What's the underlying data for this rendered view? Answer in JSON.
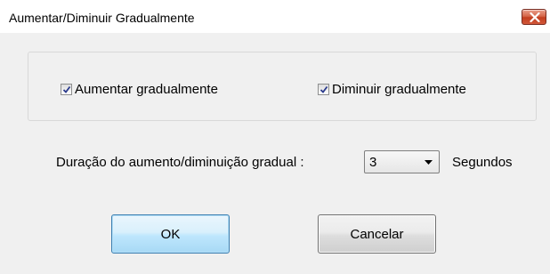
{
  "window": {
    "title": "Aumentar/Diminuir Gradualmente"
  },
  "options": {
    "fade_in": {
      "label": "Aumentar gradualmente",
      "checked": true
    },
    "fade_out": {
      "label": "Diminuir gradualmente",
      "checked": true
    }
  },
  "duration": {
    "label": "Duração do aumento/diminuição gradual :",
    "value": "3",
    "unit": "Segundos"
  },
  "buttons": {
    "ok": "OK",
    "cancel": "Cancelar"
  },
  "icons": {
    "close": "close-icon",
    "checkmark": "checkmark-icon",
    "dropdown": "chevron-down-icon"
  },
  "colors": {
    "close_button": "#c23e1f",
    "ok_button_border": "#3c7fb1",
    "dialog_background": "#f0f0f0"
  }
}
